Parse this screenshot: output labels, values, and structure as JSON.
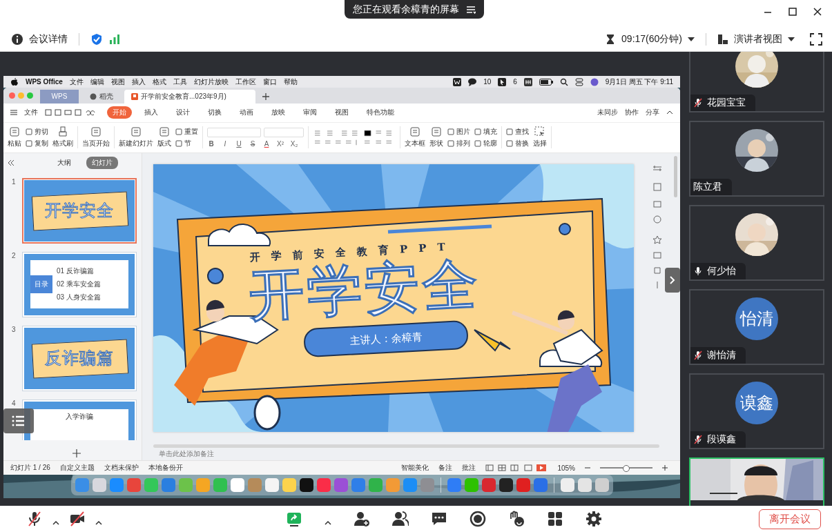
{
  "share_banner": {
    "text": "您正在观看余樟青的屏幕"
  },
  "meeting_bar": {
    "details": "会议详情",
    "timer": "09:17(60分钟)",
    "view": "演讲者视图"
  },
  "mac_menubar": {
    "app": "WPS Office",
    "menus": [
      "文件",
      "编辑",
      "视图",
      "插入",
      "格式",
      "工具",
      "幻灯片放映",
      "工作区",
      "窗口",
      "帮助"
    ],
    "counts": [
      "10",
      "6"
    ],
    "clock": "9月1日 周五 下午 9:11"
  },
  "wps": {
    "tabs": [
      {
        "label": "WPS",
        "kind": "home",
        "selected": false
      },
      {
        "label": "稻壳",
        "kind": "store",
        "selected": false
      },
      {
        "label": "开学前安全教育...023年9月)",
        "kind": "doc",
        "selected": true
      }
    ],
    "file_menu": "文件",
    "ribbon_tabs": [
      {
        "label": "开始",
        "selected": true
      },
      {
        "label": "插入",
        "selected": false
      },
      {
        "label": "设计",
        "selected": false
      },
      {
        "label": "切换",
        "selected": false
      },
      {
        "label": "动画",
        "selected": false
      },
      {
        "label": "放映",
        "selected": false
      },
      {
        "label": "审阅",
        "selected": false
      },
      {
        "label": "视图",
        "selected": false
      },
      {
        "label": "特色功能",
        "selected": false
      }
    ],
    "ribbon_right": [
      "未同步",
      "协作",
      "分享"
    ],
    "tool_groups": [
      {
        "big": [
          "粘贴"
        ],
        "small": [
          "剪切",
          "复制"
        ],
        "after": [
          "格式刷"
        ]
      },
      {
        "big": [
          "当页开始"
        ]
      },
      {
        "big": [
          "新建幻灯片",
          "版式"
        ],
        "small": [
          "重置",
          "节"
        ]
      }
    ],
    "format_glyphs": [
      "B",
      "I",
      "U",
      "S",
      "A",
      "X²",
      "X₂"
    ],
    "tool_groups_2": [
      {
        "big": [
          "文本框",
          "形状"
        ],
        "small": [
          "图片",
          "排列",
          "填充",
          "轮廓"
        ]
      },
      {
        "small": [
          "查找",
          "替换"
        ],
        "after": [
          "选择"
        ]
      }
    ],
    "panel_tabs": [
      {
        "label": "大纲",
        "selected": false
      },
      {
        "label": "幻灯片",
        "selected": true
      }
    ],
    "thumbnails": [
      {
        "number": "1",
        "kind": "cover",
        "selected": true,
        "title": "开学安全"
      },
      {
        "number": "2",
        "kind": "contents",
        "selected": false,
        "title": "目录",
        "items": [
          "01 反诈骗篇",
          "02 乘车安全篇",
          "03 人身安全篇"
        ]
      },
      {
        "number": "3",
        "kind": "section",
        "selected": false,
        "title": "反诈骗篇"
      },
      {
        "number": "4",
        "kind": "text",
        "selected": false,
        "title": "入学诈骗"
      }
    ],
    "slide": {
      "subtitle": "开学前安全教育PPT",
      "title": "开学安全",
      "presenter": "主讲人：余樟青"
    },
    "notes_placeholder": "单击此处添加备注",
    "status_left": [
      "幻灯片 1 / 26",
      "自定义主题",
      "文档未保护",
      "本地备份开"
    ],
    "status_right": [
      "智能美化",
      "备注",
      "批注"
    ],
    "zoom": {
      "value": "105%",
      "level": 0.5
    }
  },
  "dock": [
    {
      "kind": "app",
      "color": "#3a8ee6"
    },
    {
      "kind": "app",
      "color": "#d8d8de"
    },
    {
      "kind": "app",
      "color": "#1a8cff"
    },
    {
      "kind": "app",
      "color": "#e8453c"
    },
    {
      "kind": "app",
      "color": "#34c759"
    },
    {
      "kind": "app",
      "color": "#2a7fe0"
    },
    {
      "kind": "app",
      "color": "#6cc24a"
    },
    {
      "kind": "app",
      "color": "#f5a623"
    },
    {
      "kind": "app",
      "color": "#30c050"
    },
    {
      "kind": "app",
      "color": "#ffffff"
    },
    {
      "kind": "app",
      "color": "#b58b5a"
    },
    {
      "kind": "app",
      "color": "#f4f4f4"
    },
    {
      "kind": "app",
      "color": "#fcd34d"
    },
    {
      "kind": "app",
      "color": "#111111"
    },
    {
      "kind": "app",
      "color": "#fa2d48"
    },
    {
      "kind": "app",
      "color": "#9b4fd6"
    },
    {
      "kind": "app",
      "color": "#2f7fe8"
    },
    {
      "kind": "app",
      "color": "#30b34a"
    },
    {
      "kind": "app",
      "color": "#f29a36"
    },
    {
      "kind": "app",
      "color": "#1c8ef5"
    },
    {
      "kind": "app",
      "color": "#8e8e93"
    },
    {
      "kind": "separator"
    },
    {
      "kind": "app",
      "color": "#2f7df6"
    },
    {
      "kind": "app",
      "color": "#2dc100"
    },
    {
      "kind": "app",
      "color": "#d9282f"
    },
    {
      "kind": "app",
      "color": "#222222"
    },
    {
      "kind": "app",
      "color": "#e02020"
    },
    {
      "kind": "app",
      "color": "#2b6fe6"
    },
    {
      "kind": "separator"
    },
    {
      "kind": "app",
      "color": "#eeeeee"
    },
    {
      "kind": "app",
      "color": "#e4e4e4"
    },
    {
      "kind": "app",
      "color": "#cfcfcf"
    }
  ],
  "participants": [
    {
      "name": "花园宝宝",
      "muted": true
    },
    {
      "name": "陈立君"
    },
    {
      "name": "何少怡",
      "muted": false
    },
    {
      "name": "谢怡清",
      "kind": "initials",
      "initials": "怡清",
      "muted": true
    },
    {
      "name": "段谟鑫",
      "kind": "initials",
      "initials": "谟鑫",
      "muted": true
    },
    {
      "kind": "video",
      "speaking": true
    }
  ],
  "controls": {
    "mic_muted": true,
    "camera_off": true,
    "sharing": true,
    "leave": "离开会议"
  }
}
